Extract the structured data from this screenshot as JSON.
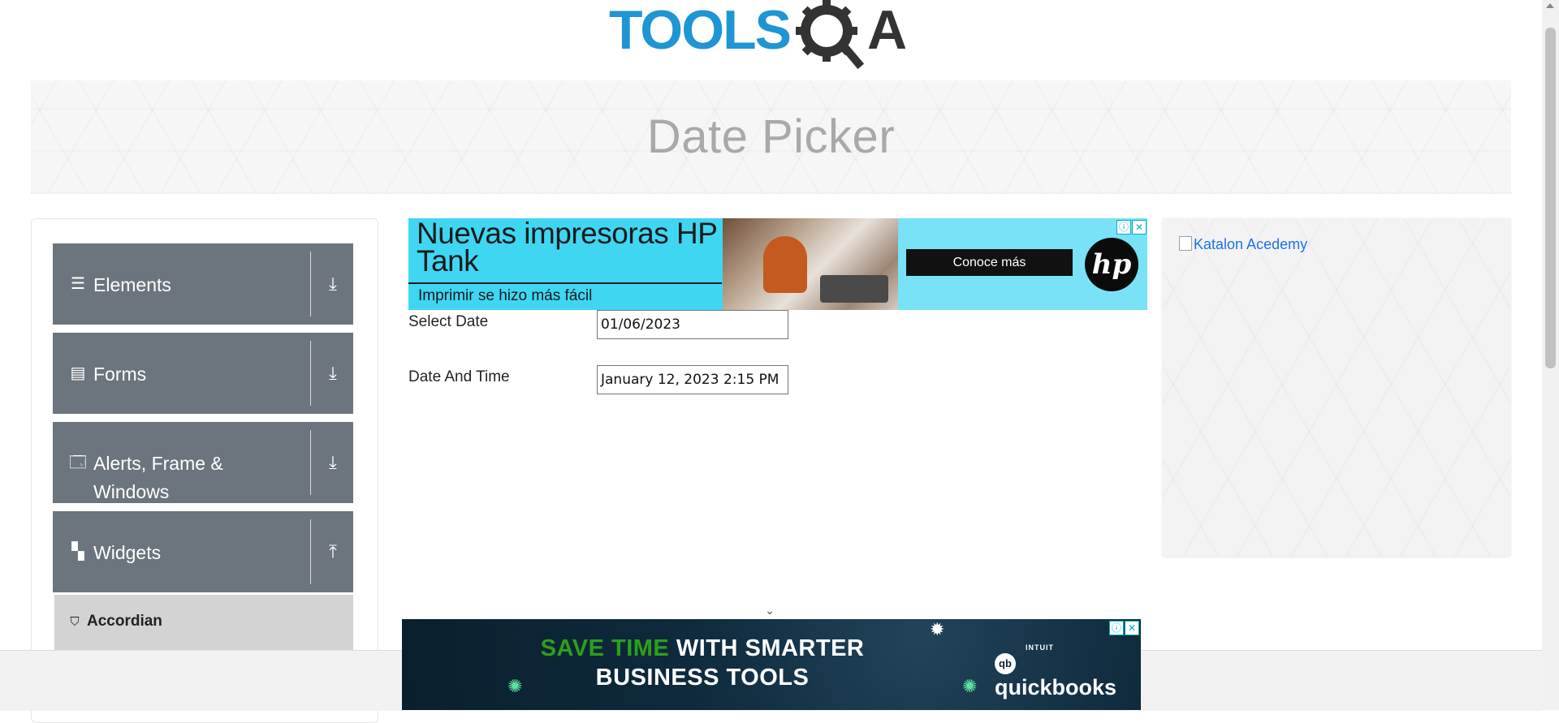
{
  "logo": {
    "text_part1": "TOOLS",
    "text_part2": "A",
    "accent": "#1f95d3",
    "dark": "#333333"
  },
  "banner": {
    "title": "Date Picker"
  },
  "sidebar": {
    "groups": [
      {
        "label": "Elements",
        "icon": "hamburger-icon",
        "toggle": "⤓"
      },
      {
        "label": "Forms",
        "icon": "document-icon",
        "toggle": "⤓"
      },
      {
        "label": "Alerts, Frame & Windows",
        "icon": "window-icon",
        "toggle": "⤓"
      },
      {
        "label": "Widgets",
        "icon": "widgets-icon",
        "toggle": "⤒"
      }
    ],
    "active_item": {
      "label": "Accordian",
      "icon": "html5-icon"
    }
  },
  "ad_top": {
    "headline": "Nuevas impresoras HP Tank",
    "subline": "Imprimir se hizo más fácil",
    "cta": "Conoce más",
    "brand": "hp",
    "bg": "#3fd6f2"
  },
  "form": {
    "select_date_label": "Select Date",
    "select_date_value": "01/06/2023",
    "date_time_label": "Date And Time",
    "date_time_value": "January 12, 2023 2:15 PM"
  },
  "right_ad": {
    "alt_text": "Katalon Acedemy"
  },
  "ad_bottom": {
    "line1_green": "SAVE TIME",
    "line1_white": "WITH SMARTER",
    "line2": "BUSINESS TOOLS",
    "brand_top": "INTUIT",
    "brand": "quickbooks",
    "brand_logo": "qb"
  },
  "colors": {
    "sidebar_group_bg": "#6c757d",
    "active_item_bg": "#d3d3d3"
  }
}
